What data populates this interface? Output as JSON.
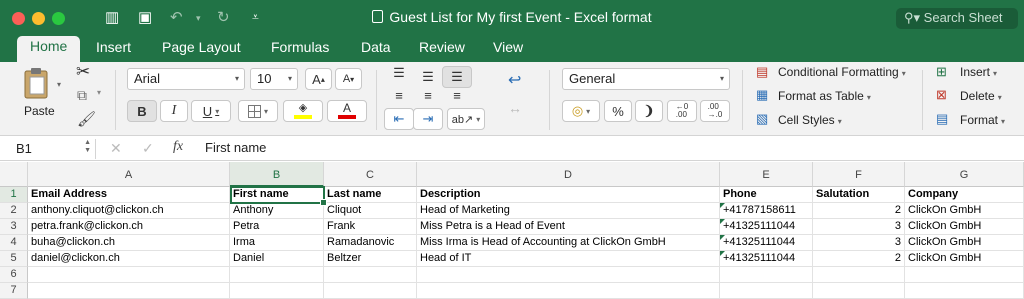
{
  "window": {
    "title": "Guest List for My first Event - Excel format",
    "search_placeholder": "Search Sheet"
  },
  "tabs": [
    "Home",
    "Insert",
    "Page Layout",
    "Formulas",
    "Data",
    "Review",
    "View"
  ],
  "ribbon": {
    "paste_label": "Paste",
    "font_name": "Arial",
    "font_size": "10",
    "bold": "B",
    "italic": "I",
    "underline": "U",
    "number_format": "General",
    "percent": "%",
    "conditional_formatting": "Conditional Formatting",
    "format_as_table": "Format as Table",
    "cell_styles": "Cell Styles",
    "insert": "Insert",
    "delete": "Delete",
    "format": "Format",
    "colors": {
      "highlight": "#ffff00",
      "font": "#e00000",
      "accent": "#217346"
    }
  },
  "formula_bar": {
    "name_box": "B1",
    "fx": "fx",
    "value": "First name"
  },
  "grid": {
    "columns": [
      "A",
      "B",
      "C",
      "D",
      "E",
      "F",
      "G"
    ],
    "rows": [
      "1",
      "2",
      "3",
      "4",
      "5",
      "6",
      "7"
    ],
    "selected_cell": "B1",
    "cells": [
      [
        "Email Address",
        "First name",
        "Last name",
        "Description",
        "Phone",
        "Salutation",
        "Company"
      ],
      [
        "anthony.cliquot@clickon.ch",
        "Anthony",
        "Cliquot",
        "Head of Marketing",
        "+41787158611",
        "2",
        "ClickOn GmbH"
      ],
      [
        "petra.frank@clickon.ch",
        "Petra",
        "Frank",
        "Miss Petra is a Head of Event",
        "+41325111044",
        "3",
        "ClickOn GmbH"
      ],
      [
        "buha@clickon.ch",
        "Irma",
        "Ramadanovic",
        "Miss Irma is Head of Accounting at ClickOn GmbH",
        "+41325111044",
        "3",
        "ClickOn GmbH"
      ],
      [
        "daniel@clickon.ch",
        "Daniel",
        "Beltzer",
        "Head of IT",
        "+41325111044",
        "2",
        "ClickOn GmbH"
      ],
      [
        "",
        "",
        "",
        "",
        "",
        "",
        ""
      ],
      [
        "",
        "",
        "",
        "",
        "",
        "",
        ""
      ]
    ]
  }
}
